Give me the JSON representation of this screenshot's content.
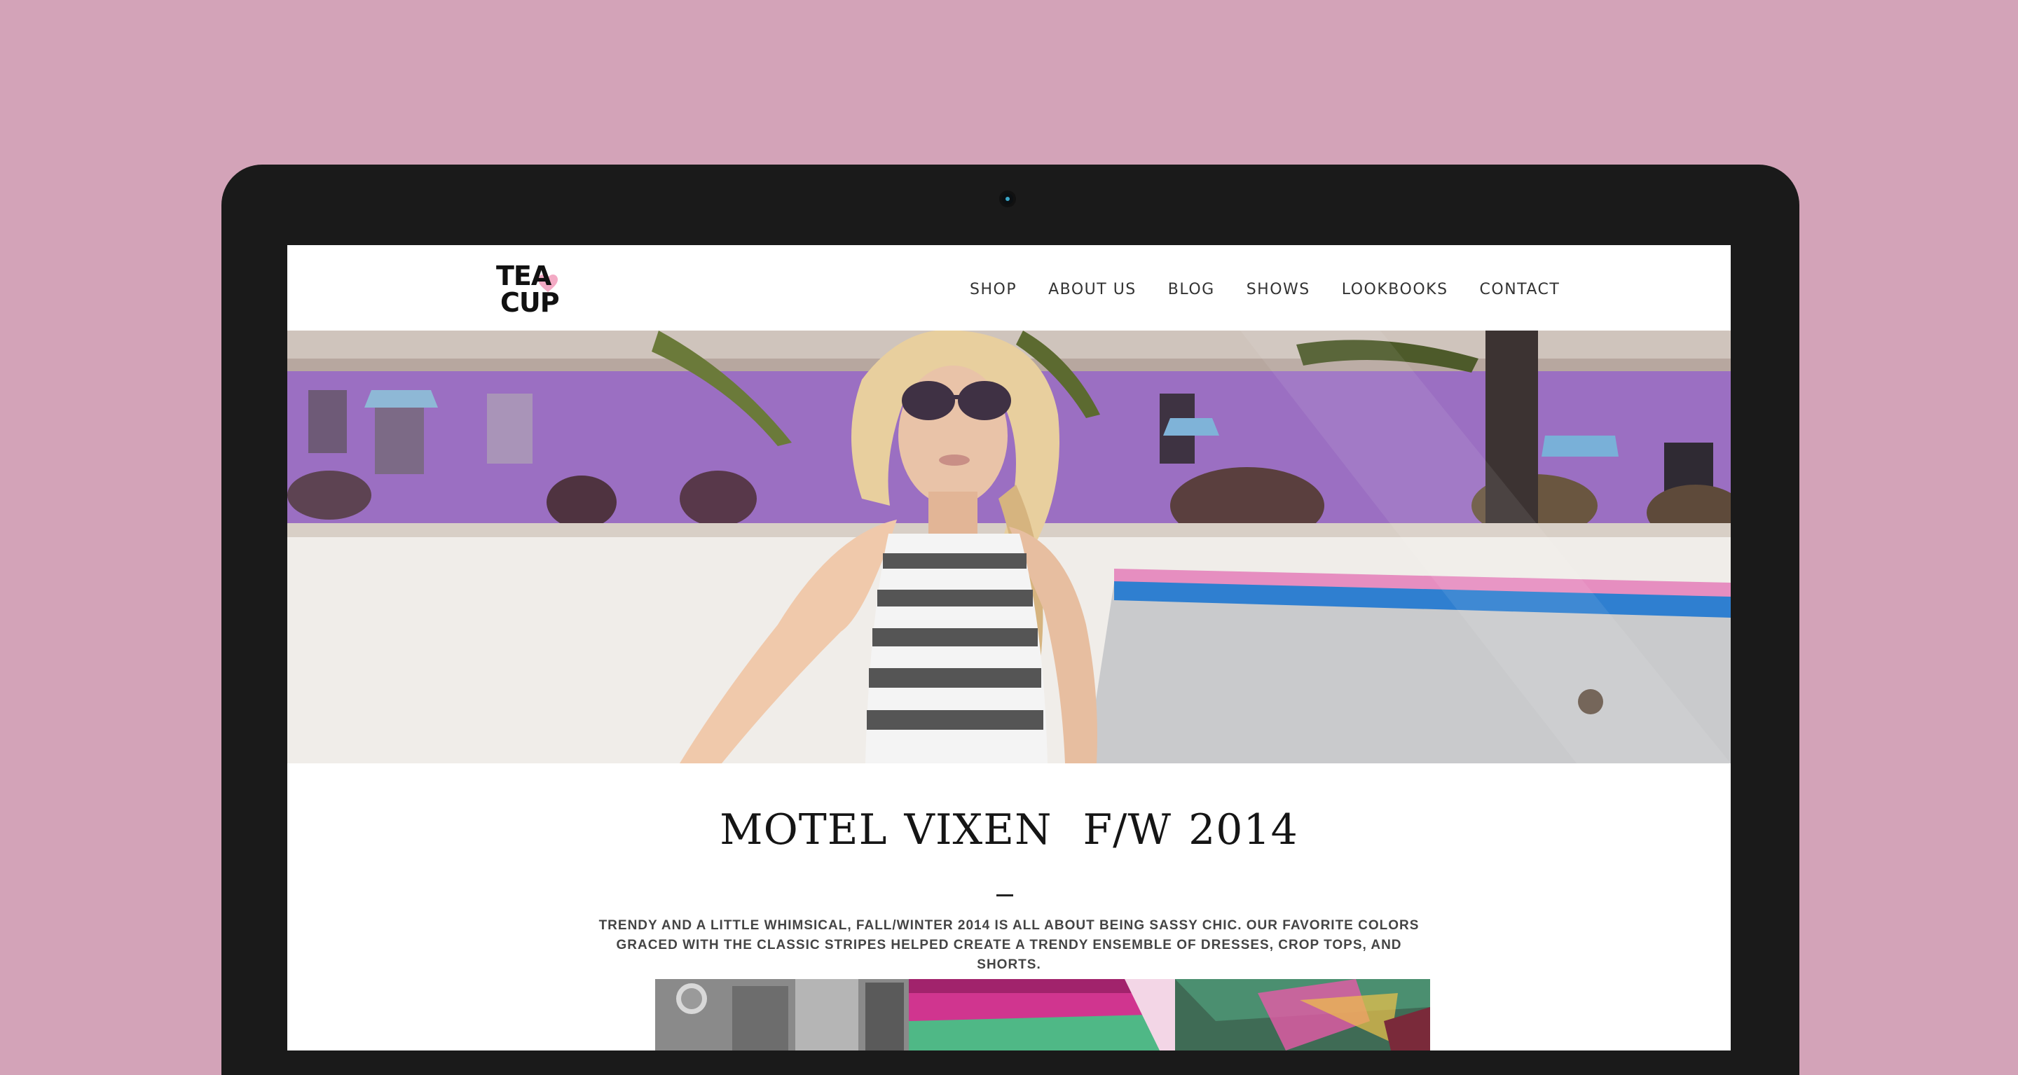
{
  "site": {
    "logo": {
      "line1": "TEA",
      "line2": "CUP",
      "accent_color": "#f3aac4"
    },
    "nav": [
      {
        "label": "SHOP"
      },
      {
        "label": "ABOUT US"
      },
      {
        "label": "BLOG"
      },
      {
        "label": "SHOWS"
      },
      {
        "label": "LOOKBOOKS"
      },
      {
        "label": "CONTACT"
      }
    ]
  },
  "hero": {
    "image": "model-in-striped-top-by-pool-photo"
  },
  "article": {
    "title_left": "MOTEL VIXEN",
    "title_right": "F/W 2014",
    "description": "TRENDY AND A LITTLE WHIMSICAL, FALL/WINTER 2014 IS ALL ABOUT BEING SASSY CHIC. OUR FAVORITE COLORS GRACED WITH THE CLASSIC STRIPES HELPED CREATE A TRENDY ENSEMBLE OF DRESSES, CROP TOPS, AND SHORTS."
  },
  "colors": {
    "background": "#d3a3b8",
    "bezel": "#1a1a1a",
    "camera": "#3aa7c8"
  }
}
